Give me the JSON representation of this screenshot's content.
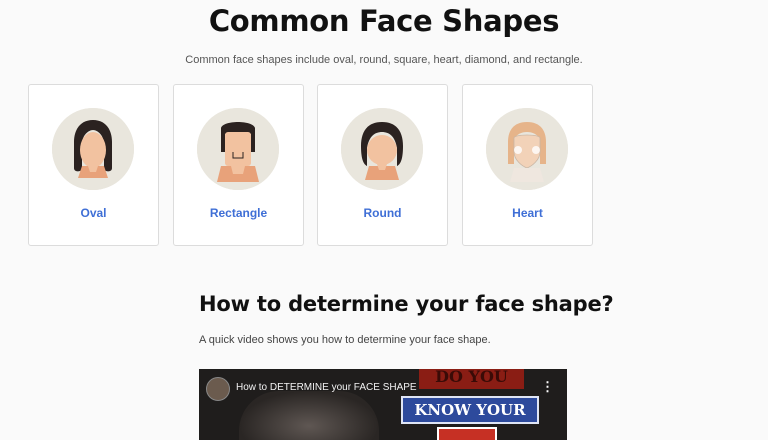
{
  "page": {
    "title": "Common Face Shapes",
    "subtitle": "Common face shapes include oval, round, square, heart, diamond, and rectangle."
  },
  "cards": [
    {
      "label": "Oval",
      "icon": "oval-face-icon"
    },
    {
      "label": "Rectangle",
      "icon": "rectangle-face-icon"
    },
    {
      "label": "Round",
      "icon": "round-face-icon"
    },
    {
      "label": "Heart",
      "icon": "heart-face-icon"
    }
  ],
  "section": {
    "title": "How to determine your face shape?",
    "text": "A quick video shows you how to determine your face shape."
  },
  "video": {
    "title": "How to DETERMINE your FACE SHAPE",
    "overlay_line1": "DO YOU",
    "overlay_line2": "KNOW YOUR",
    "menu_icon": "more-vert-icon"
  },
  "colors": {
    "accent": "#3f6fd6",
    "card_border": "#dcdcdc",
    "face_bg": "#e9e6dd",
    "skin": "#f2c2a0",
    "hair": "#2b2220"
  }
}
